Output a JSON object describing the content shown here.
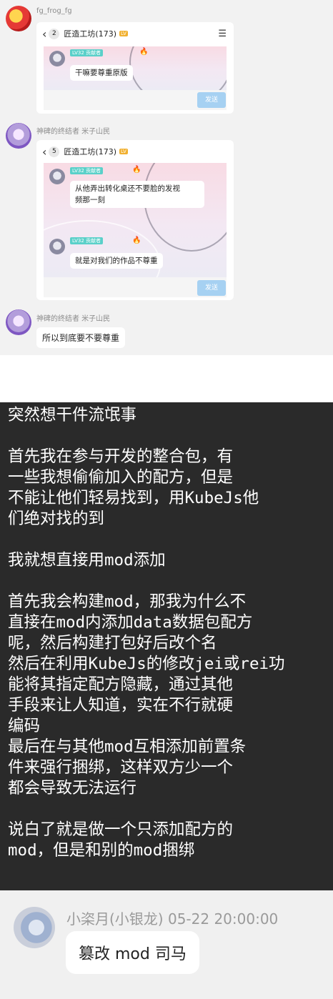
{
  "chat1": {
    "sender": "fg_frog_fg",
    "window": {
      "back_count": "2",
      "group_title": "匠造工坊(173)",
      "member_badge": "LV32 贡献者",
      "message": "干嘛要尊重原版",
      "send_label": "发送"
    }
  },
  "chat2": {
    "sender": "神碑的终结者 米子山民",
    "window": {
      "back_count": "5",
      "group_title": "匠造工坊(173)",
      "member_badge_1": "LV32 贡献者",
      "message_1_line1": "从他弄出转化桌还不要脸的发视",
      "message_1_line2": "频那一刻",
      "member_badge_2": "LV32 贡献者",
      "message_2": "就是对我们的作品不尊重",
      "send_label": "发送"
    }
  },
  "chat3": {
    "sender": "神碑的终结者 米子山民",
    "message": "所以到底要不要尊重"
  },
  "post": {
    "lines": [
      "突然想干件流氓事",
      "",
      "首先我在参与开发的整合包，有",
      "一些我想偷偷加入的配方，但是",
      "不能让他们轻易找到，用KubeJs他",
      "们绝对找的到",
      "",
      "我就想直接用mod添加",
      "",
      "首先我会构建mod，那我为什么不",
      "直接在mod内添加data数据包配方",
      "呢，然后构建打包好后改个名",
      "然后在利用KubeJs的修改jei或rei功",
      "能将其指定配方隐藏，通过其他",
      "手段来让人知道，实在不行就硬",
      "编码",
      "最后在与其他mod互相添加前置条",
      "件来强行捆绑，这样双方少一个",
      "都会导致无法运行",
      "",
      "说白了就是做一个只添加配方的",
      "mod，但是和别的mod捆绑"
    ]
  },
  "reply": {
    "sender": "小栥月(小银龙)",
    "timestamp": "05-22 20:00:00",
    "message": "篡改 mod 司马"
  }
}
